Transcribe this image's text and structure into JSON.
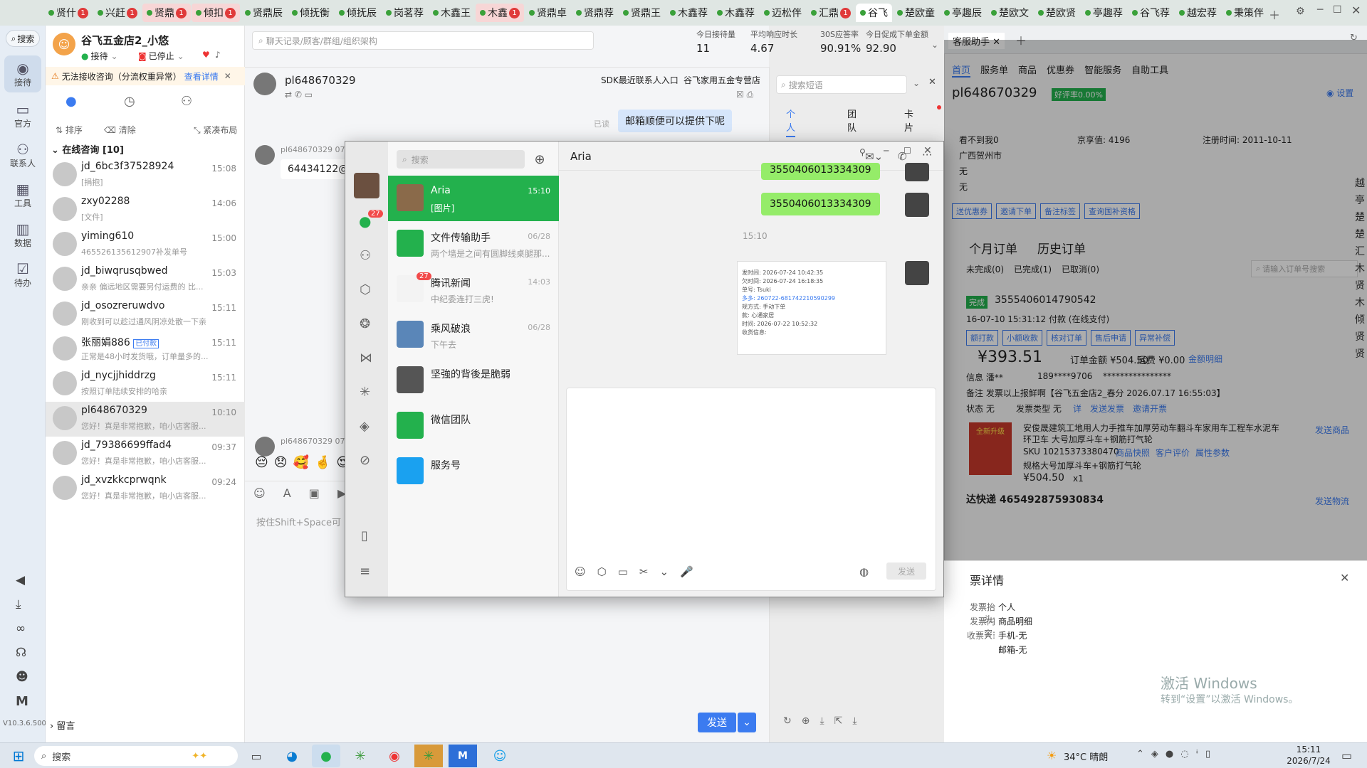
{
  "tabs": [
    {
      "label": "贤什",
      "badge": "1"
    },
    {
      "label": "兴赶",
      "badge": "1"
    },
    {
      "label": "贤鼎",
      "badge": "1",
      "pink": true
    },
    {
      "label": "倾扣",
      "badge": "1",
      "pink": true
    },
    {
      "label": "贤鼎辰"
    },
    {
      "label": "倾抚衡"
    },
    {
      "label": "倾抚辰"
    },
    {
      "label": "岗茗荐"
    },
    {
      "label": "木鑫王"
    },
    {
      "label": "木鑫",
      "badge": "1",
      "pink": true
    },
    {
      "label": "贤鼎卓"
    },
    {
      "label": "贤鼎荐"
    },
    {
      "label": "贤鼎王"
    },
    {
      "label": "木鑫荐"
    },
    {
      "label": "木鑫荐"
    },
    {
      "label": "迈松伴"
    },
    {
      "label": "汇鼎",
      "badge": "1"
    },
    {
      "label": "谷飞",
      "active": true
    },
    {
      "label": "楚欧童"
    },
    {
      "label": "亭趣辰"
    },
    {
      "label": "楚欧文"
    },
    {
      "label": "楚欧贤"
    },
    {
      "label": "亭趣荐"
    },
    {
      "label": "谷飞荐"
    },
    {
      "label": "越宏荐"
    },
    {
      "label": "秉策伴"
    }
  ],
  "rail": {
    "search": "搜索",
    "items": [
      {
        "label": "接待"
      },
      {
        "label": "官方"
      },
      {
        "label": "联系人"
      },
      {
        "label": "工具"
      },
      {
        "label": "数据"
      },
      {
        "label": "待办"
      }
    ],
    "version": "V10.3.6.500"
  },
  "shop": {
    "name": "谷飞五金店2_小悠",
    "status": "接待",
    "stopped": "已停止",
    "warning": "无法接收咨询（分流权重异常）",
    "warning_link": "查看详情",
    "actions": {
      "sort": "排序",
      "clear": "清除",
      "layout": "紧凑布局"
    },
    "section": "在线咨询 [10]",
    "bottom": "留言"
  },
  "conversations": [
    {
      "name": "jd_6bc3f37528924",
      "time": "15:08",
      "preview": "[捐抱]"
    },
    {
      "name": "zxy02288",
      "time": "14:06",
      "preview": "[文件]"
    },
    {
      "name": "yiming610",
      "time": "15:00",
      "preview": "465526135612907补发单号"
    },
    {
      "name": "jd_biwqrusqbwed",
      "time": "15:03",
      "preview": "亲亲 偏远地区需要另付运费的 比..."
    },
    {
      "name": "jd_osozreruwdvo",
      "time": "15:11",
      "preview": "刚收到可以趁过通风阴凉处散一下亲"
    },
    {
      "name": "张丽娟886",
      "tag": "已付款",
      "time": "15:11",
      "preview": "正常是48小时发货哦，订单量多的..."
    },
    {
      "name": "jd_nycjjhiddrzg",
      "time": "15:11",
      "preview": "按照订单陆续安排的哈亲"
    },
    {
      "name": "pl648670329",
      "time": "10:10",
      "preview": "您好！真是非常抱歉，咱小店客服...",
      "selected": true
    },
    {
      "name": "jd_79386699ffad4",
      "time": "09:37",
      "preview": "您好！真是非常抱歉，咱小店客服..."
    },
    {
      "name": "jd_xvzkkcprwqnk",
      "time": "09:24",
      "preview": "您好！真是非常抱歉，咱小店客服..."
    }
  ],
  "midchat": {
    "search_placeholder": "聊天记录/顾客/群组/组织架构",
    "stats": [
      {
        "label": "今日接待量",
        "value": "11"
      },
      {
        "label": "平均响应时长",
        "value": "4.67"
      },
      {
        "label": "30S应答率",
        "value": "90.91%"
      },
      {
        "label": "今日促成下单金额",
        "value": "92.90"
      }
    ],
    "customer": "pl648670329",
    "sdk": "SDK最近联系人入口",
    "store": "谷飞家用五金专营店",
    "read": "已读",
    "msg_out": "邮箱顺便可以提供下呢",
    "msg_in_name": "pl648670329",
    "msg_in_time": "07-",
    "msg_in": "64434122@q",
    "msg_in2_name": "pl648670329",
    "msg_in2_time": "07-",
    "input_hint": "按住Shift+Space可",
    "send": "发送"
  },
  "shortcuts": {
    "search_placeholder": "搜索短语",
    "tabs": [
      "个人",
      "团队",
      "卡片"
    ]
  },
  "rightpanel": {
    "tab_title": "客服助手",
    "nav": [
      "首页",
      "服务单",
      "商品",
      "优惠券",
      "智能服务",
      "自助工具"
    ],
    "customer": "pl648670329",
    "rating": "好评率0.00%",
    "settings": "设置",
    "info": {
      "nick": "看不到我0",
      "jingdou": "京享值: 4196",
      "reg": "注册时间: 2011-10-11",
      "addr": "广西贺州市",
      "f1": "无",
      "f2": "无"
    },
    "buttons": [
      "送优惠券",
      "邀请下单",
      "备注标签",
      "查询国补资格"
    ],
    "order_tabs": [
      "个月订单",
      "历史订单"
    ],
    "order_filters": [
      "未完成(0)",
      "已完成(1)",
      "已取消(0)"
    ],
    "order_search": "请输入订单号搜索",
    "order": {
      "status": "完成",
      "id": "3555406014790542",
      "time": "16-07-10 15:31:12 付款 (在线支付)",
      "actions": [
        "额打款",
        "小额收款",
        "核对订单",
        "售后申请",
        "异常补偿"
      ],
      "price": "¥393.51",
      "amount": "订单金额 ¥504.50",
      "freight": "运费 ¥0.00",
      "detail": "金额明细",
      "contact": "信息 潘**",
      "phone": "189****9706",
      "masked": "****************",
      "remark": "备注 发票以上报鲜啊【谷飞五金店2_春分 2026.07.17 16:55:03】",
      "inv_status": "状态 无",
      "inv_type": "发票类型 无",
      "inv_links": [
        "详",
        "发送发票",
        "邀请开票"
      ],
      "product": "安俊晟建筑工地用人力手推车加厚劳动车翻斗车家用车工程车水泥车环卫车 大号加厚斗车+钢筋打气轮",
      "send_product": "发送商品",
      "sku": "SKU 10215373380470",
      "sku_links": [
        "商品快照",
        "客户评价",
        "属性参数"
      ],
      "spec": "规格大号加厚斗车+钢筋打气轮",
      "sku_price": "¥504.50",
      "qty": "x1",
      "express": "达快递 465492875930834",
      "send_logistics": "发送物流",
      "product_img_text": "全新升级"
    },
    "invoice": {
      "title": "票详情",
      "rows": [
        {
          "k": "发票抬头:",
          "v": "个人"
        },
        {
          "k": "发票内容:",
          "v": "商品明细"
        },
        {
          "k": "收票人:",
          "v": "手机-无"
        },
        {
          "k": "",
          "v": "邮箱-无"
        }
      ]
    },
    "side_letters": [
      "越",
      "亭",
      "楚",
      "楚",
      "汇",
      "木",
      "贤",
      "木",
      "倾",
      "贤",
      "贤"
    ],
    "activation": "激活 Windows",
    "activation_sub": "转到“设置”以激活 Windows。"
  },
  "wechat": {
    "search": "搜索",
    "chat_title": "Aria",
    "rail_badge": "27",
    "contacts": [
      {
        "name": "Aria",
        "preview": "[图片]",
        "time": "15:10",
        "selected": true,
        "color": "#8a6a4a"
      },
      {
        "name": "文件传输助手",
        "preview": "两个墙是之间有圆脚线桌腿那...",
        "time": "06/28",
        "color": "#23b14d"
      },
      {
        "name": "腾讯新闻",
        "preview": "中纪委连打三虎!",
        "time": "14:03",
        "badge": "27",
        "color": "#f3f3f3"
      },
      {
        "name": "乘风破浪",
        "preview": "下午去",
        "time": "06/28",
        "color": "#5a86b8"
      },
      {
        "name": "坚強的背後是脆弱",
        "preview": "",
        "time": "",
        "color": "#555"
      },
      {
        "name": "微信团队",
        "preview": "",
        "time": "",
        "color": "#23b14d"
      },
      {
        "name": "服务号",
        "preview": "",
        "time": "",
        "color": "#1aa1f0"
      }
    ],
    "msg1": "3550406013334309",
    "msg2": "3550406013334309",
    "time_sep": "15:10",
    "card": {
      "l1": "发时间: 2026-07-24 10:42:35",
      "l2": "欠时间: 2026-07-24 16:18:35",
      "l3": "单号: Tsuki",
      "l4": "多多: 260722-681742210590299",
      "l5": "规方式: 手动下单",
      "l6": "款: 心通家居",
      "l7": "时间: 2026-07-22 10:52:32",
      "l8": "收货信息:"
    },
    "send": "发送"
  },
  "taskbar": {
    "search": "搜索",
    "weather": "34°C 晴朗",
    "time": "15:11",
    "date": "2026/7/24"
  },
  "colors": {
    "accent": "#3b7bf0",
    "wechat_green": "#23b14d",
    "bubble": "#95ec69",
    "warn": "#e57a1c"
  }
}
